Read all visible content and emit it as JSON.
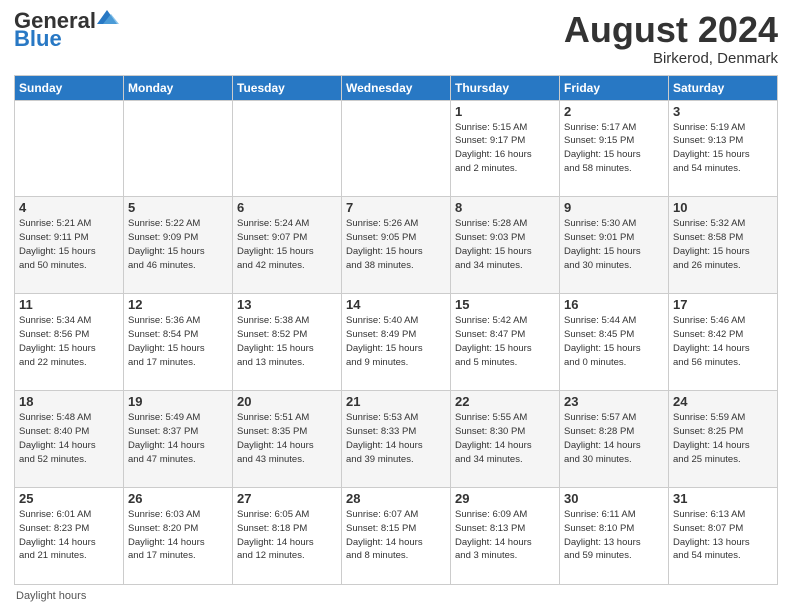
{
  "logo": {
    "text_general": "General",
    "text_blue": "Blue"
  },
  "title": "August 2024",
  "location": "Birkerod, Denmark",
  "days_of_week": [
    "Sunday",
    "Monday",
    "Tuesday",
    "Wednesday",
    "Thursday",
    "Friday",
    "Saturday"
  ],
  "footer": "Daylight hours",
  "weeks": [
    [
      {
        "day": "",
        "info": ""
      },
      {
        "day": "",
        "info": ""
      },
      {
        "day": "",
        "info": ""
      },
      {
        "day": "",
        "info": ""
      },
      {
        "day": "1",
        "info": "Sunrise: 5:15 AM\nSunset: 9:17 PM\nDaylight: 16 hours\nand 2 minutes."
      },
      {
        "day": "2",
        "info": "Sunrise: 5:17 AM\nSunset: 9:15 PM\nDaylight: 15 hours\nand 58 minutes."
      },
      {
        "day": "3",
        "info": "Sunrise: 5:19 AM\nSunset: 9:13 PM\nDaylight: 15 hours\nand 54 minutes."
      }
    ],
    [
      {
        "day": "4",
        "info": "Sunrise: 5:21 AM\nSunset: 9:11 PM\nDaylight: 15 hours\nand 50 minutes."
      },
      {
        "day": "5",
        "info": "Sunrise: 5:22 AM\nSunset: 9:09 PM\nDaylight: 15 hours\nand 46 minutes."
      },
      {
        "day": "6",
        "info": "Sunrise: 5:24 AM\nSunset: 9:07 PM\nDaylight: 15 hours\nand 42 minutes."
      },
      {
        "day": "7",
        "info": "Sunrise: 5:26 AM\nSunset: 9:05 PM\nDaylight: 15 hours\nand 38 minutes."
      },
      {
        "day": "8",
        "info": "Sunrise: 5:28 AM\nSunset: 9:03 PM\nDaylight: 15 hours\nand 34 minutes."
      },
      {
        "day": "9",
        "info": "Sunrise: 5:30 AM\nSunset: 9:01 PM\nDaylight: 15 hours\nand 30 minutes."
      },
      {
        "day": "10",
        "info": "Sunrise: 5:32 AM\nSunset: 8:58 PM\nDaylight: 15 hours\nand 26 minutes."
      }
    ],
    [
      {
        "day": "11",
        "info": "Sunrise: 5:34 AM\nSunset: 8:56 PM\nDaylight: 15 hours\nand 22 minutes."
      },
      {
        "day": "12",
        "info": "Sunrise: 5:36 AM\nSunset: 8:54 PM\nDaylight: 15 hours\nand 17 minutes."
      },
      {
        "day": "13",
        "info": "Sunrise: 5:38 AM\nSunset: 8:52 PM\nDaylight: 15 hours\nand 13 minutes."
      },
      {
        "day": "14",
        "info": "Sunrise: 5:40 AM\nSunset: 8:49 PM\nDaylight: 15 hours\nand 9 minutes."
      },
      {
        "day": "15",
        "info": "Sunrise: 5:42 AM\nSunset: 8:47 PM\nDaylight: 15 hours\nand 5 minutes."
      },
      {
        "day": "16",
        "info": "Sunrise: 5:44 AM\nSunset: 8:45 PM\nDaylight: 15 hours\nand 0 minutes."
      },
      {
        "day": "17",
        "info": "Sunrise: 5:46 AM\nSunset: 8:42 PM\nDaylight: 14 hours\nand 56 minutes."
      }
    ],
    [
      {
        "day": "18",
        "info": "Sunrise: 5:48 AM\nSunset: 8:40 PM\nDaylight: 14 hours\nand 52 minutes."
      },
      {
        "day": "19",
        "info": "Sunrise: 5:49 AM\nSunset: 8:37 PM\nDaylight: 14 hours\nand 47 minutes."
      },
      {
        "day": "20",
        "info": "Sunrise: 5:51 AM\nSunset: 8:35 PM\nDaylight: 14 hours\nand 43 minutes."
      },
      {
        "day": "21",
        "info": "Sunrise: 5:53 AM\nSunset: 8:33 PM\nDaylight: 14 hours\nand 39 minutes."
      },
      {
        "day": "22",
        "info": "Sunrise: 5:55 AM\nSunset: 8:30 PM\nDaylight: 14 hours\nand 34 minutes."
      },
      {
        "day": "23",
        "info": "Sunrise: 5:57 AM\nSunset: 8:28 PM\nDaylight: 14 hours\nand 30 minutes."
      },
      {
        "day": "24",
        "info": "Sunrise: 5:59 AM\nSunset: 8:25 PM\nDaylight: 14 hours\nand 25 minutes."
      }
    ],
    [
      {
        "day": "25",
        "info": "Sunrise: 6:01 AM\nSunset: 8:23 PM\nDaylight: 14 hours\nand 21 minutes."
      },
      {
        "day": "26",
        "info": "Sunrise: 6:03 AM\nSunset: 8:20 PM\nDaylight: 14 hours\nand 17 minutes."
      },
      {
        "day": "27",
        "info": "Sunrise: 6:05 AM\nSunset: 8:18 PM\nDaylight: 14 hours\nand 12 minutes."
      },
      {
        "day": "28",
        "info": "Sunrise: 6:07 AM\nSunset: 8:15 PM\nDaylight: 14 hours\nand 8 minutes."
      },
      {
        "day": "29",
        "info": "Sunrise: 6:09 AM\nSunset: 8:13 PM\nDaylight: 14 hours\nand 3 minutes."
      },
      {
        "day": "30",
        "info": "Sunrise: 6:11 AM\nSunset: 8:10 PM\nDaylight: 13 hours\nand 59 minutes."
      },
      {
        "day": "31",
        "info": "Sunrise: 6:13 AM\nSunset: 8:07 PM\nDaylight: 13 hours\nand 54 minutes."
      }
    ]
  ]
}
